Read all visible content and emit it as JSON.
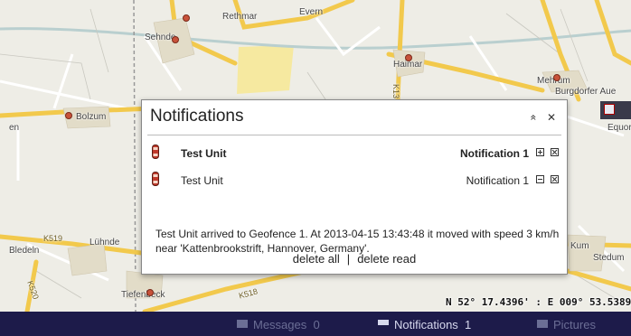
{
  "map": {
    "places": [
      "Rethmar",
      "Evern",
      "Sehnde",
      "Haimar",
      "Mehrum",
      "Burgdorfer Aue",
      "Bolzum",
      "Equord",
      "Bledeln",
      "Lühnde",
      "Tiefenbeck",
      "Stedum",
      "Kum",
      "en"
    ],
    "road_labels": [
      "K519",
      "K520",
      "K518",
      "K13"
    ],
    "coordinate_readout": "N 52° 17.4396' : E 009° 53.5389'"
  },
  "panel": {
    "title": "Notifications",
    "collapse_glyph": "»",
    "close_glyph": "✕",
    "rows": [
      {
        "unit": "Test Unit",
        "notification": "Notification 1"
      },
      {
        "unit": "Test Unit",
        "notification": "Notification 1"
      }
    ],
    "message": "Test Unit arrived to Geofence 1. At 2013-04-15 13:43:48 it moved with speed 3 km/h near 'Kattenbrookstrift, Hannover, Germany'.",
    "delete_all": "delete all",
    "separator": "|",
    "delete_read": "delete read"
  },
  "statusbar": {
    "messages": "Messages",
    "messages_count": "0",
    "notifications": "Notifications",
    "notifications_count": "1",
    "pictures": "Pictures"
  },
  "colors": {
    "statusbar_bg": "#1d1b4a",
    "road_major": "#f2c94c",
    "road_minor": "#ffffff",
    "unit_marker": "#c0392b"
  }
}
